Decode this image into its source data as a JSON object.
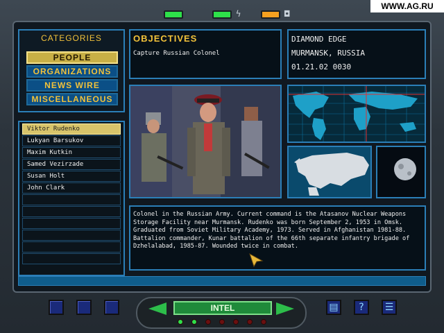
{
  "watermark": "WWW.AG.RU",
  "top_indicators": [
    {
      "name": "power",
      "color": "#2ee04a",
      "glyph": ""
    },
    {
      "name": "energy",
      "color": "#2ee04a",
      "glyph": "ϟ"
    },
    {
      "name": "camera",
      "color": "#f5a020",
      "glyph": "◘"
    }
  ],
  "categories": {
    "title": "CATEGORIES",
    "items": [
      "PEOPLE",
      "ORGANIZATIONS",
      "NEWS WIRE",
      "MISCELLANEOUS"
    ],
    "active": "PEOPLE"
  },
  "people": {
    "items": [
      "Viktor Rudenko",
      "Lukyan Barsukov",
      "Maxim Kutkin",
      "Samed Vezirzade",
      "Susan Holt",
      "John Clark"
    ],
    "selected": "Viktor Rudenko"
  },
  "objectives": {
    "title": "OBJECTIVES",
    "text": "Capture Russian Colonel"
  },
  "location": {
    "mission": "DIAMOND EDGE",
    "place": "MURMANSK, RUSSIA",
    "datetime": "01.21.02 0030"
  },
  "bio": "Colonel in the Russian Army. Current command is the Atasanov Nuclear Weapons\nStorage Facility near Murmansk. Rudenko was born September 2, 1953 in Omsk.\nGraduated from Soviet Military Academy, 1973.  Served in Afghanistan 1981-88.\nBattalion commander, Kunar battalion of the 66th separate infantry brigade of\nDzhelalabad, 1985-87.  Wounded twice in combat.",
  "bottom": {
    "intel_label": "INTEL",
    "colors": {
      "accent": "#2b7fb8",
      "highlight": "#f2c23a",
      "go": "#2dbd4a"
    }
  }
}
